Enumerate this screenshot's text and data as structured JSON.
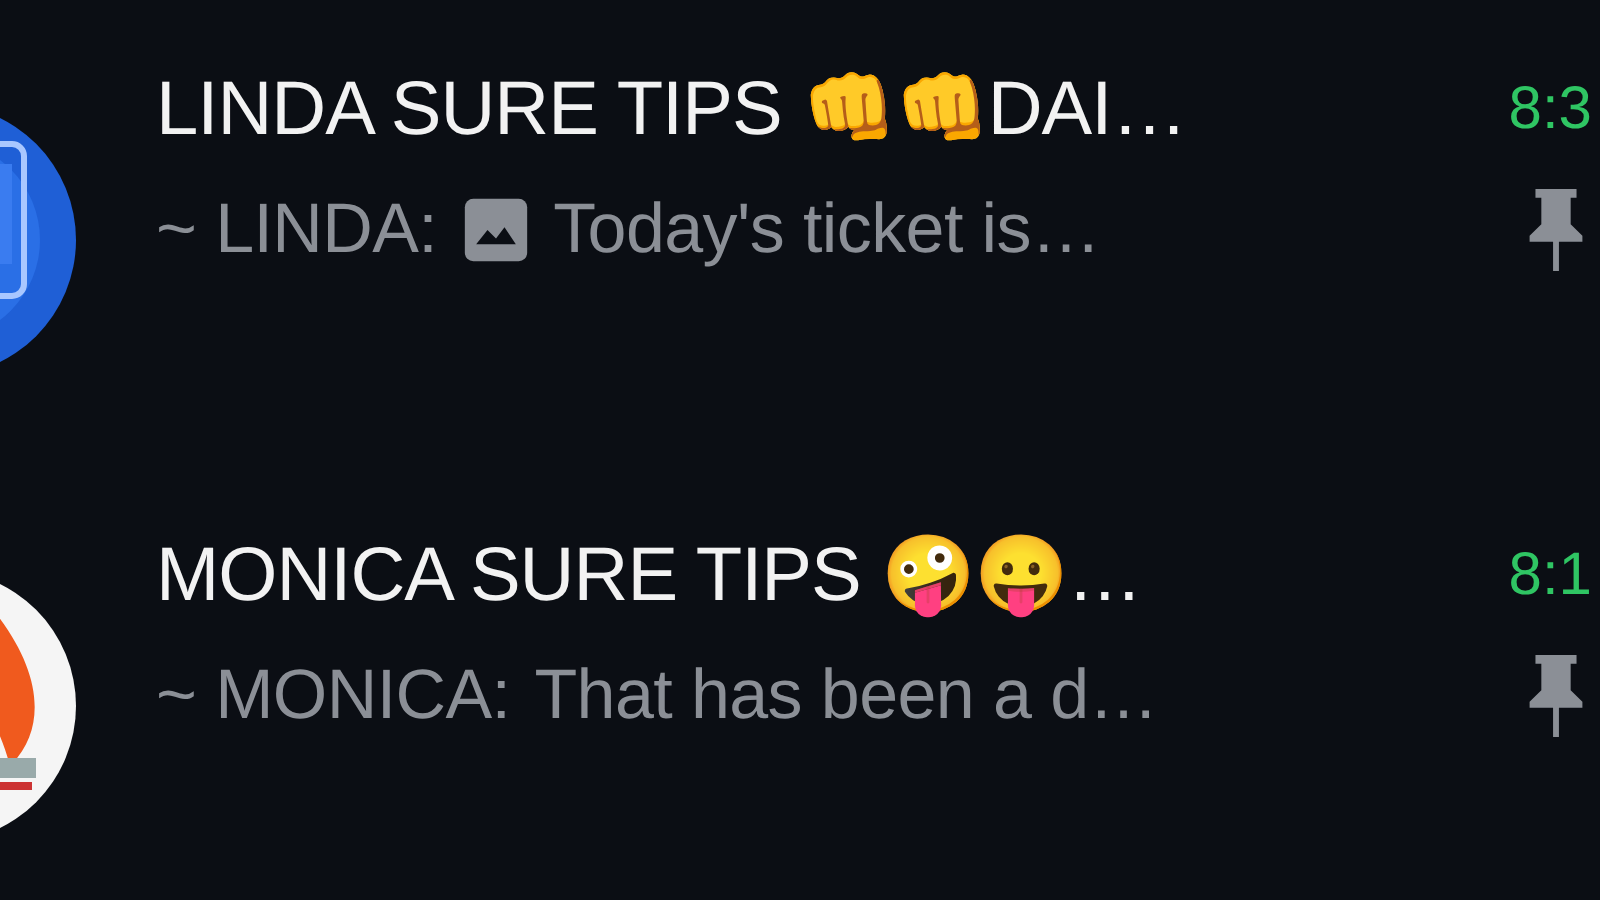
{
  "chats": [
    {
      "title": "LINDA SURE TIPS 👊👊DAI…",
      "time": "8:3",
      "preview": {
        "sender": "~ LINDA:",
        "has_image": true,
        "text": "Today's ticket is…"
      },
      "pinned": true
    },
    {
      "title": "MONICA SURE TIPS 🤪😛…",
      "time": "8:1",
      "preview": {
        "sender": "~ MONICA:",
        "has_image": false,
        "text": "That has been a d…"
      },
      "pinned": true
    }
  ]
}
